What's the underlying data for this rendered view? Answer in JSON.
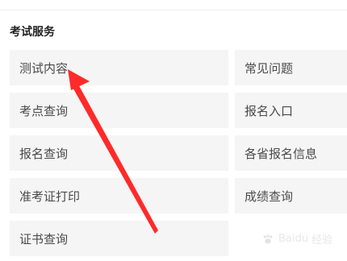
{
  "section": {
    "title": "考试服务"
  },
  "services": {
    "left": [
      "测试内容",
      "考点查询",
      "报名查询",
      "准考证打印",
      "证书查询"
    ],
    "right": [
      "常见问题",
      "报名入口",
      "各省报名信息",
      "成绩查询"
    ]
  },
  "watermark": {
    "brand": "Baidu",
    "text": "经验"
  },
  "colors": {
    "arrow": "#ff2a2a",
    "tile_bg": "#f5f5f5",
    "text": "#4a4a4a"
  }
}
